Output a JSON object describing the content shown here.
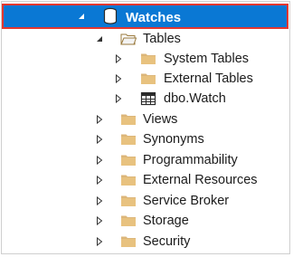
{
  "tree": {
    "root": {
      "label": "Watches",
      "icon": "database-icon",
      "expanded": true,
      "selected": true
    },
    "tables": {
      "label": "Tables",
      "icon": "open-folder-icon",
      "expanded": true
    },
    "children": [
      {
        "label": "System Tables",
        "icon": "folder-icon"
      },
      {
        "label": "External Tables",
        "icon": "folder-icon"
      },
      {
        "label": "dbo.Watch",
        "icon": "table-icon"
      }
    ],
    "items": [
      {
        "label": "Views",
        "icon": "folder-icon"
      },
      {
        "label": "Synonyms",
        "icon": "folder-icon"
      },
      {
        "label": "Programmability",
        "icon": "folder-icon"
      },
      {
        "label": "External Resources",
        "icon": "folder-icon"
      },
      {
        "label": "Service Broker",
        "icon": "folder-icon"
      },
      {
        "label": "Storage",
        "icon": "folder-icon"
      },
      {
        "label": "Security",
        "icon": "folder-icon"
      }
    ]
  },
  "colors": {
    "selection": "#0a78d4",
    "highlight_border": "#e4372f",
    "folder": "#dcb67a",
    "text": "#1b1b1b"
  }
}
